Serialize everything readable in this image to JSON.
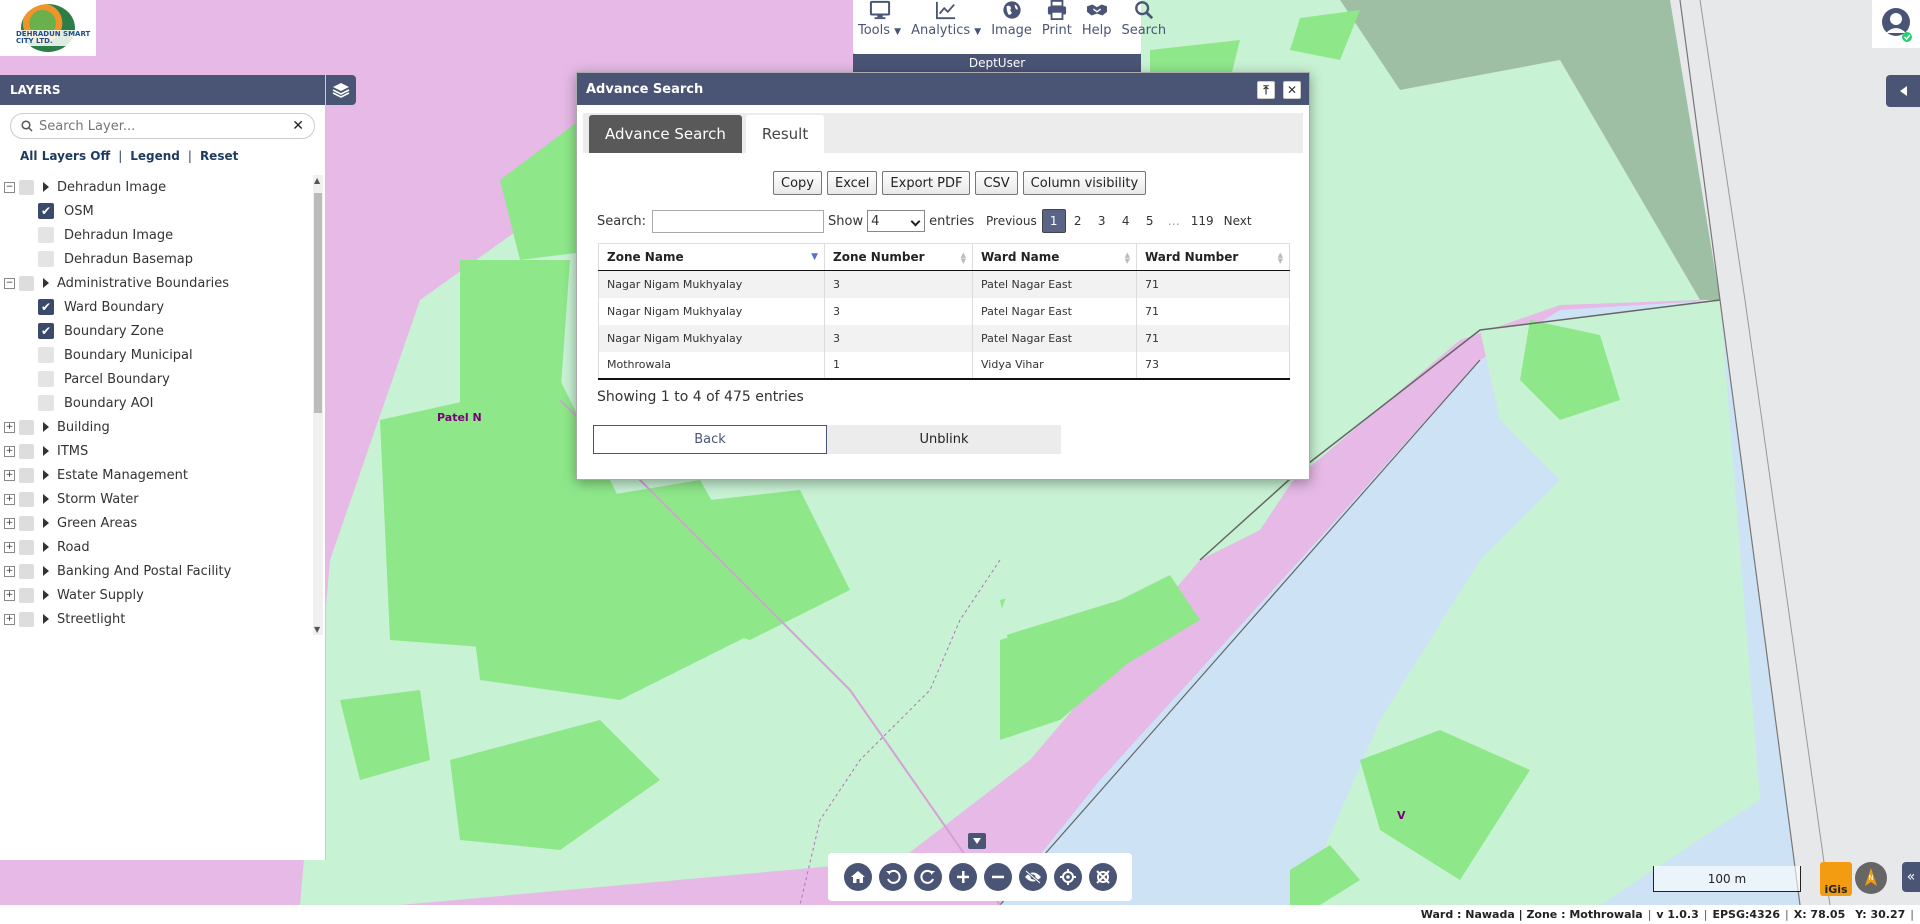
{
  "logo": {
    "text": "DEHRADUN SMART CITY LTD."
  },
  "layers": {
    "title": "LAYERS",
    "search_placeholder": "Search Layer...",
    "links": [
      "All Layers Off",
      "Legend",
      "Reset"
    ],
    "groups": [
      {
        "label": "Dehradun Image",
        "children": [
          {
            "label": "OSM",
            "checked": true
          },
          {
            "label": "Dehradun Image",
            "checked": false
          },
          {
            "label": "Dehradun Basemap",
            "checked": false
          }
        ]
      },
      {
        "label": "Administrative Boundaries",
        "children": [
          {
            "label": "Ward Boundary",
            "checked": true
          },
          {
            "label": "Boundary Zone",
            "checked": true
          },
          {
            "label": "Boundary Municipal",
            "checked": false
          },
          {
            "label": "Parcel Boundary",
            "checked": false
          },
          {
            "label": "Boundary AOI",
            "checked": false
          }
        ]
      },
      {
        "label": "Building"
      },
      {
        "label": "ITMS"
      },
      {
        "label": "Estate Management"
      },
      {
        "label": "Storm Water"
      },
      {
        "label": "Green Areas"
      },
      {
        "label": "Road"
      },
      {
        "label": "Banking And Postal Facility"
      },
      {
        "label": "Water Supply"
      },
      {
        "label": "Streetlight"
      }
    ]
  },
  "toolbar": {
    "items": [
      {
        "label": "Tools",
        "icon": "monitor-icon",
        "dropdown": true
      },
      {
        "label": "Analytics",
        "icon": "chart-line-icon",
        "dropdown": true
      },
      {
        "label": "Image",
        "icon": "globe-icon"
      },
      {
        "label": "Print",
        "icon": "printer-icon"
      },
      {
        "label": "Help",
        "icon": "handshake-icon"
      },
      {
        "label": "Search",
        "icon": "search-icon"
      }
    ],
    "user_bar": "DeptUser"
  },
  "dialog": {
    "title": "Advance Search",
    "tabs": [
      "Advance Search",
      "Result"
    ],
    "export_buttons": [
      "Copy",
      "Excel",
      "Export PDF",
      "CSV",
      "Column visibility"
    ],
    "search_label": "Search:",
    "show_label": "Show",
    "show_value": "4",
    "entries_label": "entries",
    "pager": {
      "previous": "Previous",
      "pages": [
        "1",
        "2",
        "3",
        "4",
        "5"
      ],
      "ellipsis": "…",
      "last": "119",
      "next": "Next",
      "current": "1"
    },
    "columns": [
      "Zone Name",
      "Zone Number",
      "Ward Name",
      "Ward Number"
    ],
    "rows": [
      [
        "Nagar Nigam Mukhyalay",
        "3",
        "Patel Nagar East",
        "71"
      ],
      [
        "Nagar Nigam Mukhyalay",
        "3",
        "Patel Nagar East",
        "71"
      ],
      [
        "Nagar Nigam Mukhyalay",
        "3",
        "Patel Nagar East",
        "71"
      ],
      [
        "Mothrowala",
        "1",
        "Vidya Vihar",
        "73"
      ]
    ],
    "showing": "Showing 1 to 4 of 475 entries",
    "back_label": "Back",
    "unblink_label": "Unblink"
  },
  "map": {
    "labels": [
      "Patel N",
      "V"
    ],
    "scale": "100 m",
    "igis": "iGis"
  },
  "status": {
    "ward": "Ward : Nawada | Zone : Mothrowala",
    "version": "v 1.0.3",
    "epsg": "EPSG:4326",
    "x": "X: 78.05",
    "y": "Y: 30.27"
  },
  "colors": {
    "header": "#4a5576",
    "map_pink": "#e6b9e6",
    "map_light_green": "#c8f2d4",
    "map_green": "#8ee88a",
    "map_blue": "#cde2f5",
    "map_dark_green": "#9fbfa5"
  }
}
